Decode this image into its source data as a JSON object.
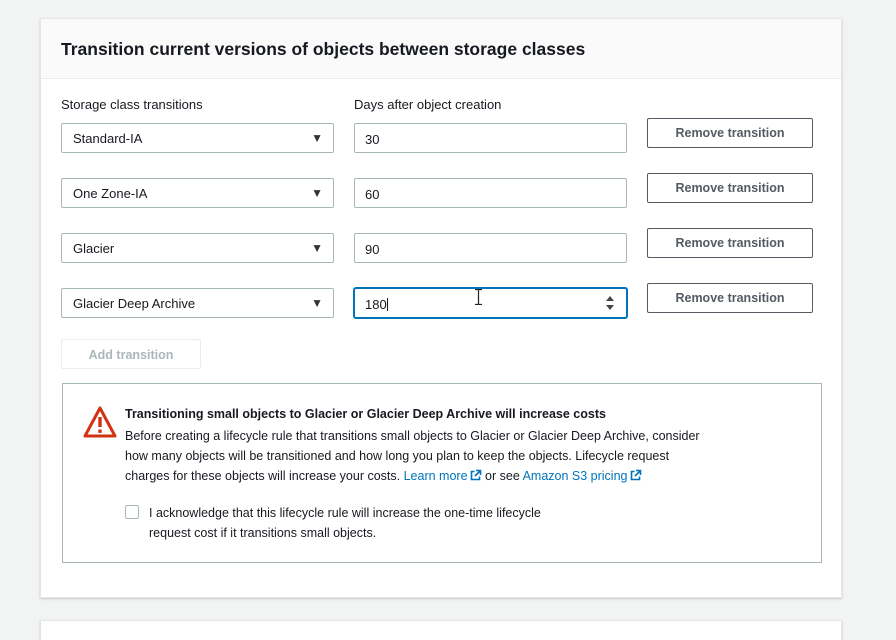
{
  "panel": {
    "title": "Transition current versions of objects between storage classes"
  },
  "columns": {
    "storage_class_label": "Storage class transitions",
    "days_label": "Days after object creation"
  },
  "transitions": [
    {
      "storage_class": "Standard-IA",
      "days": "30",
      "remove_label": "Remove transition"
    },
    {
      "storage_class": "One Zone-IA",
      "days": "60",
      "remove_label": "Remove transition"
    },
    {
      "storage_class": "Glacier",
      "days": "90",
      "remove_label": "Remove transition"
    },
    {
      "storage_class": "Glacier Deep Archive",
      "days": "180",
      "remove_label": "Remove transition"
    }
  ],
  "add_transition_label": "Add transition",
  "alert": {
    "title": "Transitioning small objects to Glacier or Glacier Deep Archive will increase costs",
    "line1": "Before creating a lifecycle rule that transitions small objects to Glacier or Glacier Deep Archive, consider",
    "line2": "how many objects will be transitioned and how long you plan to keep the objects. Lifecycle request",
    "line3_prefix": "charges for these objects will increase your costs.",
    "learn_more": "Learn more",
    "or_see": "or see",
    "pricing_link": "Amazon S3 pricing",
    "ack_line1": "I acknowledge that this lifecycle rule will increase the one-time lifecycle",
    "ack_line2": "request cost if it transitions small objects.",
    "acknowledged": false
  },
  "icons": {
    "dropdown": "caret-down-icon",
    "warning": "warning-triangle-icon",
    "external": "external-link-icon"
  },
  "colors": {
    "link": "#0073bb",
    "warning": "#d13212",
    "focus": "#0073bb"
  }
}
